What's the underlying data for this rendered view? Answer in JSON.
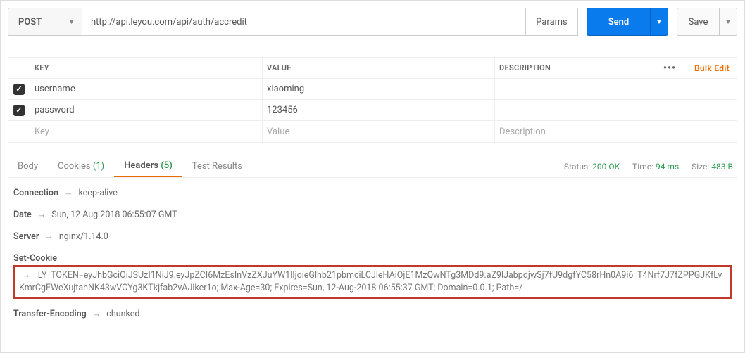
{
  "request": {
    "method": "POST",
    "url": "http://api.leyou.com/api/auth/accredit",
    "params_btn": "Params",
    "send_btn": "Send",
    "save_btn": "Save"
  },
  "param_headers": {
    "key": "KEY",
    "value": "VALUE",
    "description": "DESCRIPTION",
    "bulk": "Bulk Edit"
  },
  "params": [
    {
      "checked": true,
      "key": "username",
      "value": "xiaoming",
      "desc": ""
    },
    {
      "checked": true,
      "key": "password",
      "value": "123456",
      "desc": ""
    }
  ],
  "placeholders": {
    "key": "Key",
    "value": "Value",
    "desc": "Description"
  },
  "tabs": {
    "body": "Body",
    "cookies": "Cookies",
    "cookies_count": "(1)",
    "headers": "Headers",
    "headers_count": "(5)",
    "tests": "Test Results"
  },
  "status": {
    "status_label": "Status:",
    "status_value": "200 OK",
    "time_label": "Time:",
    "time_value": "94 ms",
    "size_label": "Size:",
    "size_value": "483 B"
  },
  "resp_headers": {
    "connection": {
      "name": "Connection",
      "value": "keep-alive"
    },
    "date": {
      "name": "Date",
      "value": "Sun, 12 Aug 2018 06:55:07 GMT"
    },
    "server": {
      "name": "Server",
      "value": "nginx/1.14.0"
    },
    "set_cookie": {
      "name": "Set-Cookie",
      "value": "LY_TOKEN=eyJhbGciOiJSUzI1NiJ9.eyJpZCI6MzEsInVzZXJuYW1lIjoieGlhb21pbmciLCJleHAiOjE1MzQwNTg3MDd9.aZ9lJabpdjwSj7fU9dgfYC58rHn0A9i6_T4Nrf7J7fZPPGJKfLvKmrCgEWeXujtahNK43wVCYg3KTkjfab2vAJlker1o; Max-Age=30; Expires=Sun, 12-Aug-2018 06:55:37 GMT; Domain=0.0.1; Path=/"
    },
    "transfer_encoding": {
      "name": "Transfer-Encoding",
      "value": "chunked"
    }
  },
  "arrow": "→"
}
